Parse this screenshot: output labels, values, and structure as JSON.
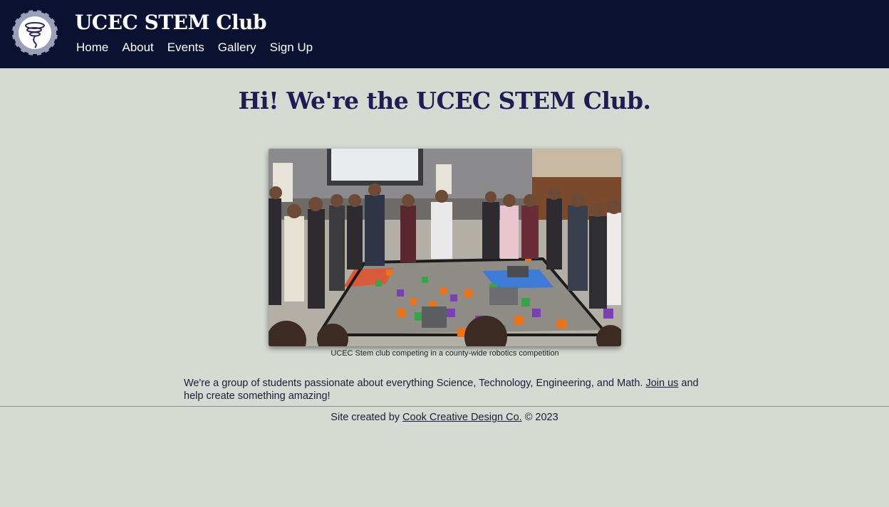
{
  "header": {
    "title": "UCEC STEM Club",
    "nav": [
      "Home",
      "About",
      "Events",
      "Gallery",
      "Sign Up"
    ]
  },
  "main": {
    "headline": "Hi! We're the UCEC STEM Club.",
    "photo_caption": "UCEC Stem club competing in a county-wide robotics competition",
    "intro_text_before": "We're a group of students passionate about everything Science, Technology, Engineering, and Math. ",
    "intro_link": "Join us",
    "intro_text_after": " and help create something amazing!"
  },
  "footer": {
    "text_before": "Site created by ",
    "link": "Cook Creative Design Co.",
    "text_after": " © 2023"
  },
  "colors": {
    "header_bg": "#0b1130",
    "page_bg": "#d5dbd3",
    "headline": "#1f1c52"
  },
  "icons": {
    "logo": "gear-tornado-logo"
  }
}
